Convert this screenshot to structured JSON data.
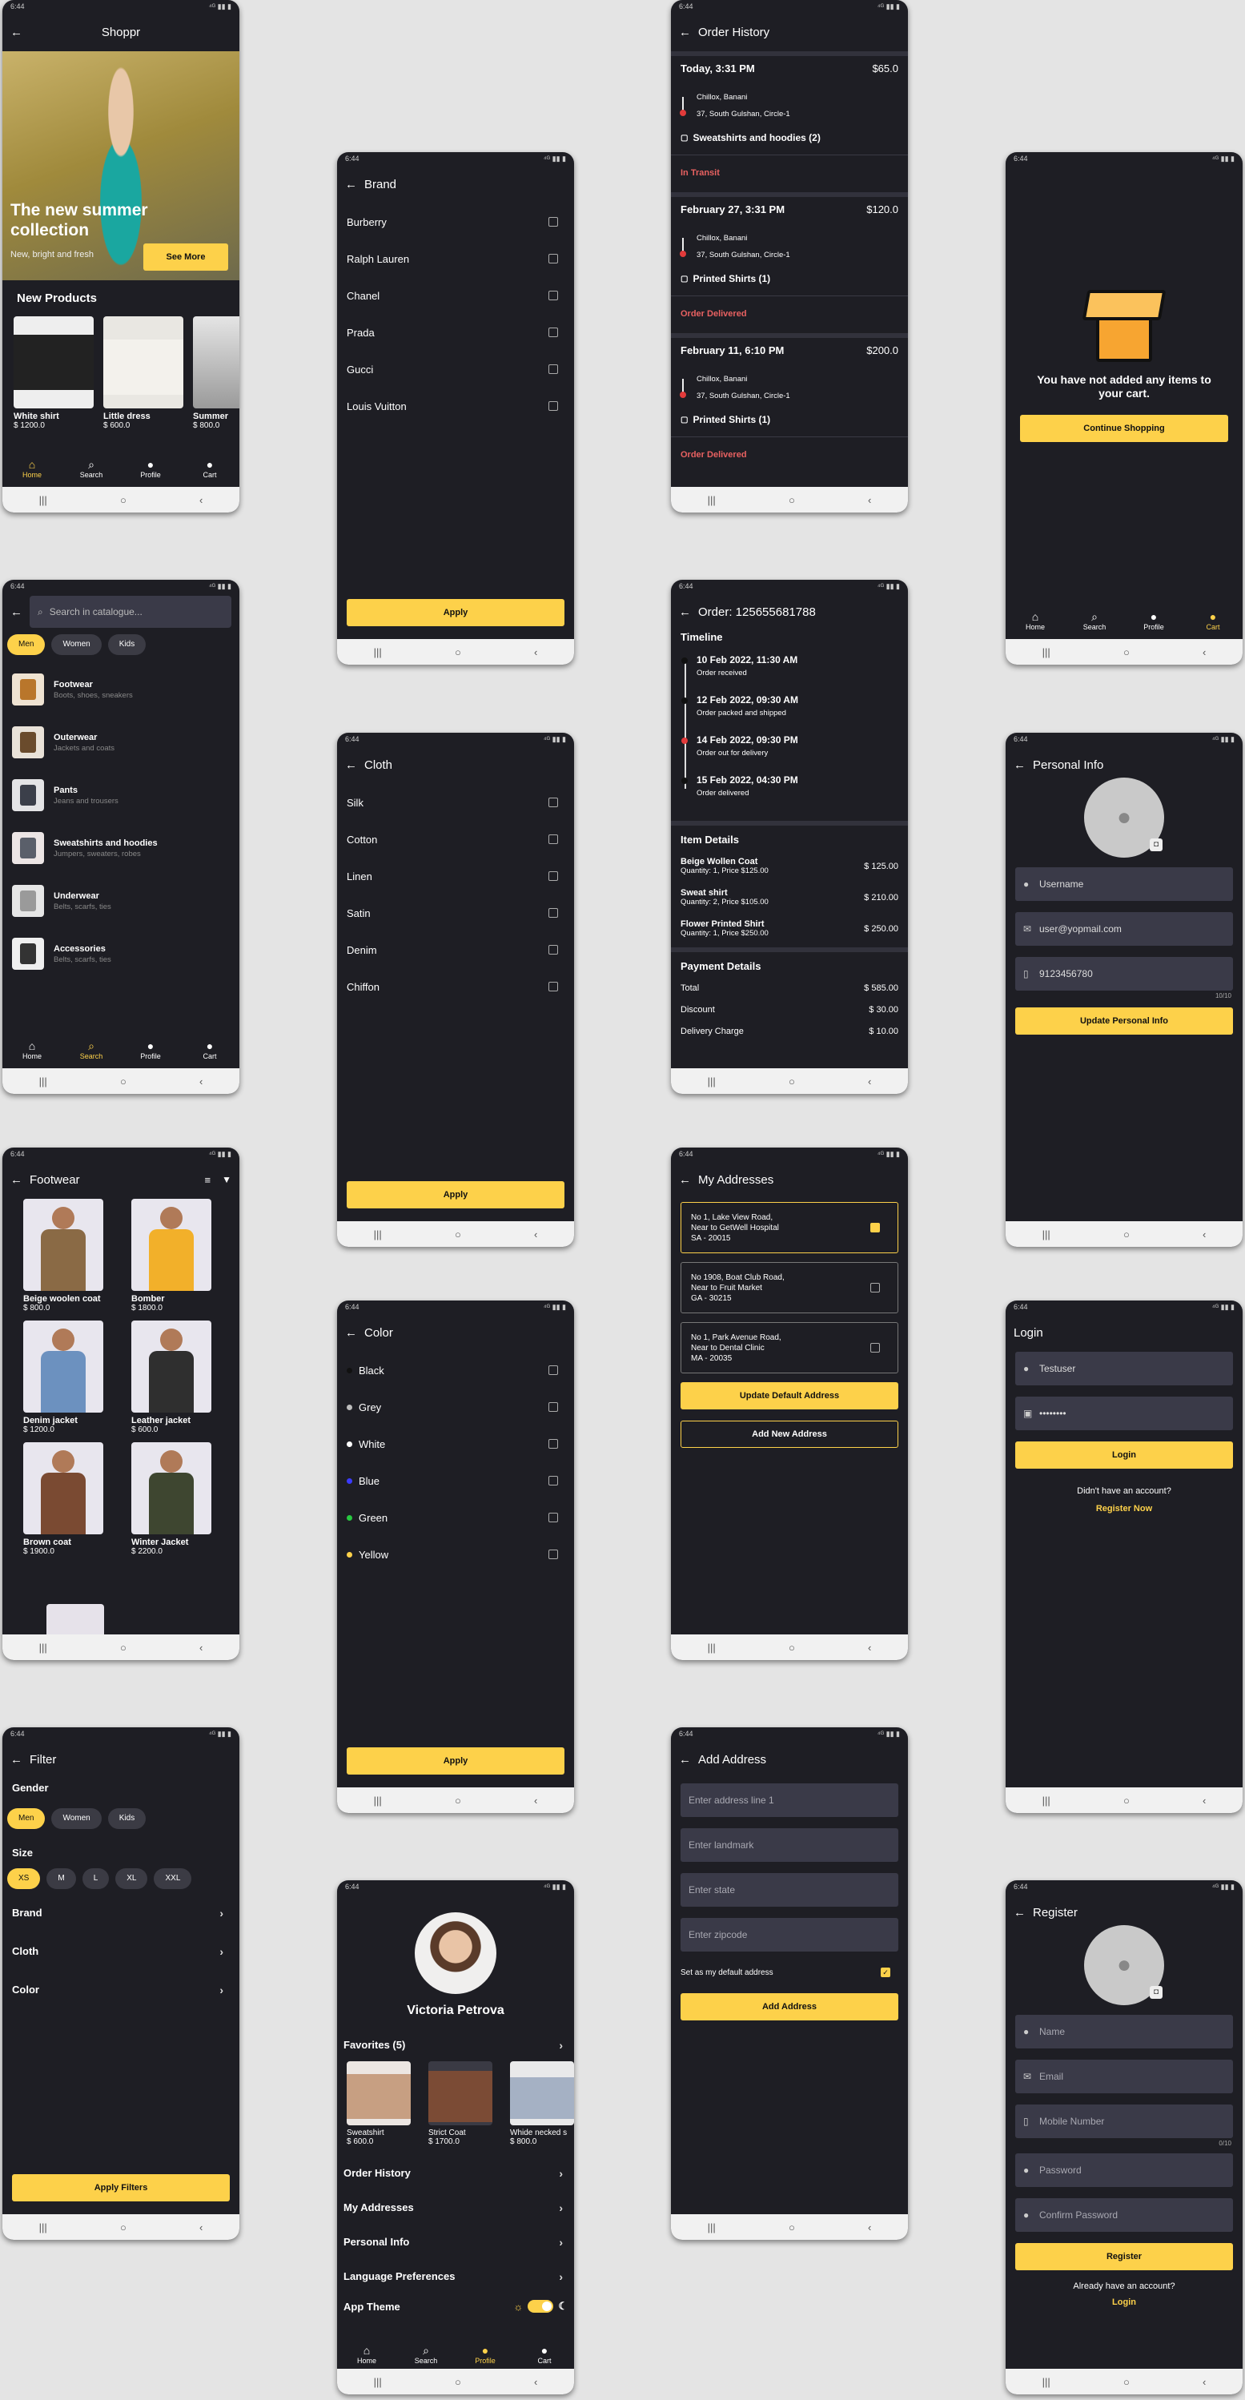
{
  "status": {
    "time": "6:44",
    "icons": "⁴ᴳ ▮▮ ▮"
  },
  "nav_glyphs": {
    "recent": "|||",
    "home": "○",
    "back": "‹"
  },
  "icons": {
    "back": "←",
    "chevron": "›",
    "search": "⌕",
    "home": "⌂",
    "profile": "●",
    "cart": "●",
    "check": "✓",
    "filter": "▼",
    "sort": "≡",
    "person": "●",
    "mail": "✉",
    "phone": "▯",
    "lock": "▣",
    "camera": "◘",
    "sun": "☼",
    "moon": "☾",
    "bag": "▢"
  },
  "bottom_nav": [
    "Home",
    "Search",
    "Profile",
    "Cart"
  ],
  "home": {
    "title": "Shoppr",
    "hero_title": "The new summer collection",
    "hero_sub": "New, bright and fresh",
    "hero_button": "See More",
    "section": "New Products",
    "products": [
      {
        "name": "White shirt",
        "price": "$ 1200.0"
      },
      {
        "name": "Little dress",
        "price": "$ 600.0"
      },
      {
        "name": "Summer",
        "price": "$ 800.0"
      }
    ]
  },
  "search": {
    "placeholder": "Search in catalogue...",
    "chips": [
      "Men",
      "Women",
      "Kids"
    ],
    "categories": [
      {
        "title": "Footwear",
        "sub": "Boots, shoes, sneakers"
      },
      {
        "title": "Outerwear",
        "sub": "Jackets and coats"
      },
      {
        "title": "Pants",
        "sub": "Jeans and trousers"
      },
      {
        "title": "Sweatshirts and hoodies",
        "sub": "Jumpers, sweaters, robes"
      },
      {
        "title": "Underwear",
        "sub": "Belts, scarfs, ties"
      },
      {
        "title": "Accessories",
        "sub": "Belts, scarfs, ties"
      }
    ]
  },
  "footwear": {
    "title": "Footwear",
    "items": [
      {
        "name": "Beige woolen coat",
        "price": "$ 800.0"
      },
      {
        "name": "Bomber",
        "price": "$ 1800.0"
      },
      {
        "name": "Denim jacket",
        "price": "$ 1200.0"
      },
      {
        "name": "Leather jacket",
        "price": "$ 600.0"
      },
      {
        "name": "Brown coat",
        "price": "$ 1900.0"
      },
      {
        "name": "Winter Jacket",
        "price": "$ 2200.0"
      }
    ]
  },
  "filter": {
    "title": "Filter",
    "gender_label": "Gender",
    "genders": [
      "Men",
      "Women",
      "Kids"
    ],
    "size_label": "Size",
    "sizes": [
      "XS",
      "M",
      "L",
      "XL",
      "XXL"
    ],
    "rows": [
      "Brand",
      "Cloth",
      "Color"
    ],
    "apply": "Apply Filters"
  },
  "brand": {
    "title": "Brand",
    "options": [
      "Burberry",
      "Ralph Lauren",
      "Chanel",
      "Prada",
      "Gucci",
      "Louis Vuitton"
    ],
    "apply": "Apply"
  },
  "cloth": {
    "title": "Cloth",
    "options": [
      "Silk",
      "Cotton",
      "Linen",
      "Satin",
      "Denim",
      "Chiffon"
    ],
    "apply": "Apply"
  },
  "color": {
    "title": "Color",
    "options": [
      {
        "name": "Black",
        "hex": "#111111"
      },
      {
        "name": "Grey",
        "hex": "#bdbdbd"
      },
      {
        "name": "White",
        "hex": "#ffffff"
      },
      {
        "name": "Blue",
        "hex": "#3b3bff"
      },
      {
        "name": "Green",
        "hex": "#28c840"
      },
      {
        "name": "Yellow",
        "hex": "#fdd14a"
      }
    ],
    "apply": "Apply"
  },
  "profile": {
    "name": "Victoria Petrova",
    "favorites": "Favorites (5)",
    "fav_items": [
      {
        "name": "Sweatshirt",
        "price": "$ 600.0"
      },
      {
        "name": "Strict Coat",
        "price": "$ 1700.0"
      },
      {
        "name": "Whide necked s",
        "price": "$ 800.0"
      }
    ],
    "menu": [
      "Order History",
      "My Addresses",
      "Personal Info",
      "Language Preferences"
    ],
    "theme": "App Theme"
  },
  "orders": {
    "title": "Order History",
    "list": [
      {
        "date": "Today, 3:31 PM",
        "amount": "$65.0",
        "from": "Chillox, Banani",
        "to": "37, South Gulshan, Circle-1",
        "item": "Sweatshirts and hoodies (2)",
        "status": "In Transit"
      },
      {
        "date": "February 27, 3:31 PM",
        "amount": "$120.0",
        "from": "Chillox, Banani",
        "to": "37, South Gulshan, Circle-1",
        "item": "Printed Shirts (1)",
        "status": "Order Delivered"
      },
      {
        "date": "February 11, 6:10 PM",
        "amount": "$200.0",
        "from": "Chillox, Banani",
        "to": "37, South Gulshan, Circle-1",
        "item": "Printed Shirts (1)",
        "status": "Order Delivered"
      }
    ]
  },
  "order": {
    "title": "Order: 125655681788",
    "timeline_label": "Timeline",
    "timeline": [
      {
        "date": "10 Feb 2022, 11:30 AM",
        "text": "Order received"
      },
      {
        "date": "12 Feb 2022, 09:30 AM",
        "text": "Order packed and shipped"
      },
      {
        "date": "14 Feb 2022, 09:30 PM",
        "text": "Order out for delivery"
      },
      {
        "date": "15 Feb 2022, 04:30 PM",
        "text": "Order delivered"
      }
    ],
    "items_label": "Item Details",
    "items": [
      {
        "name": "Beige Wollen Coat",
        "qty": "Quantity: 1, Price $125.00",
        "total": "$ 125.00"
      },
      {
        "name": "Sweat shirt",
        "qty": "Quantity: 2, Price $105.00",
        "total": "$ 210.00"
      },
      {
        "name": "Flower Printed Shirt",
        "qty": "Quantity: 1, Price $250.00",
        "total": "$ 250.00"
      }
    ],
    "payment_label": "Payment Details",
    "payment": [
      {
        "label": "Total",
        "value": "$ 585.00"
      },
      {
        "label": "Discount",
        "value": "$ 30.00"
      },
      {
        "label": "Delivery Charge",
        "value": "$ 10.00"
      }
    ]
  },
  "addresses": {
    "title": "My Addresses",
    "list": [
      {
        "l1": "No 1, Lake View Road,",
        "l2": "Near to GetWell Hospital",
        "l3": "SA - 20015"
      },
      {
        "l1": "No 1908, Boat Club Road,",
        "l2": "Near to Fruit Market",
        "l3": "GA - 30215"
      },
      {
        "l1": "No 1, Park Avenue Road,",
        "l2": "Near to Dental Clinic",
        "l3": "MA - 20035"
      }
    ],
    "update": "Update Default Address",
    "add": "Add New Address"
  },
  "add_address": {
    "title": "Add Address",
    "fields": [
      "Enter address line 1",
      "Enter landmark",
      "Enter state",
      "Enter zipcode"
    ],
    "default_label": "Set as my default address",
    "button": "Add Address"
  },
  "cart": {
    "message": "You have not added any items to your cart.",
    "button": "Continue Shopping"
  },
  "personal": {
    "title": "Personal Info",
    "username": "Username",
    "email": "user@yopmail.com",
    "phone": "9123456780",
    "counter": "10/10",
    "button": "Update Personal Info"
  },
  "login": {
    "title": "Login",
    "username": "Testuser",
    "password": "••••••••",
    "button": "Login",
    "prompt": "Didn't have an account?",
    "link": "Register Now"
  },
  "register": {
    "title": "Register",
    "fields": [
      "Name",
      "Email",
      "Mobile Number",
      "Password",
      "Confirm Password"
    ],
    "counter": "0/10",
    "button": "Register",
    "prompt": "Already have an account?",
    "link": "Login"
  }
}
